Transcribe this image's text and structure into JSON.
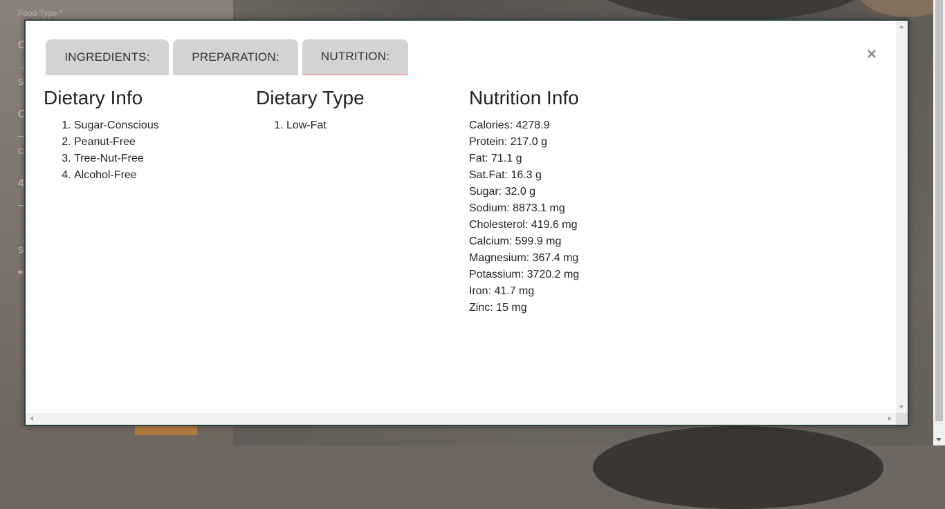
{
  "background": {
    "food_type_label": "Food Type *",
    "letters": [
      "C",
      "S",
      "C",
      "C",
      "4",
      "S"
    ]
  },
  "tabs": [
    {
      "label": "INGREDIENTS:"
    },
    {
      "label": "PREPARATION:"
    },
    {
      "label": "NUTRITION:"
    }
  ],
  "active_tab": "NUTRITION:",
  "close_icon": "×",
  "dietary_info": {
    "title": "Dietary Info",
    "items": [
      "Sugar-Conscious",
      "Peanut-Free",
      "Tree-Nut-Free",
      "Alcohol-Free"
    ]
  },
  "dietary_type": {
    "title": "Dietary Type",
    "items": [
      "Low-Fat"
    ]
  },
  "nutrition_info": {
    "title": "Nutrition Info",
    "items": [
      "Calories: 4278.9",
      "Protein: 217.0 g",
      "Fat: 71.1 g",
      "Sat.Fat: 16.3 g",
      "Sugar: 32.0 g",
      "Sodium: 8873.1 mg",
      "Cholesterol: 419.6 mg",
      "Calcium: 599.9 mg",
      "Magnesium: 367.4 mg",
      "Potassium: 3720.2 mg",
      "Iron: 41.7 mg",
      "Zinc: 15 mg"
    ]
  },
  "colors": {
    "modal_border": "#2e4540",
    "tab_bg": "#d3d3d3",
    "active_tab_underline": "#f3a6a6"
  }
}
